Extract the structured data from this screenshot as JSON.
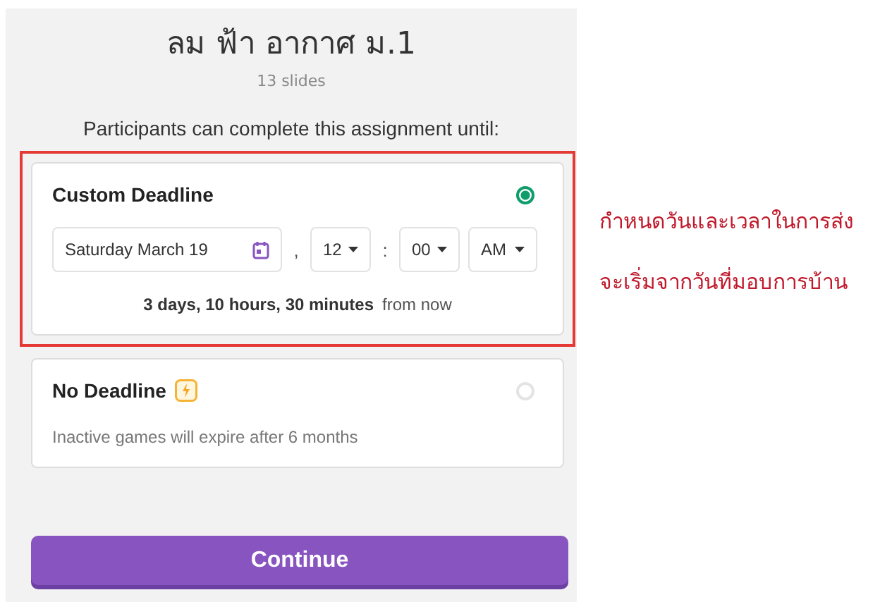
{
  "title": "ลม ฟ้า อากาศ ม.1",
  "subtitle": "13 slides",
  "prompt": "Participants can complete this assignment until:",
  "options": [
    {
      "kind": "custom",
      "title": "Custom Deadline",
      "selected": true,
      "highlighted": true,
      "date": "Saturday March 19",
      "comma": ",",
      "hour": "12",
      "colon": ":",
      "minute": "00",
      "period": "AM",
      "duration": "3 days, 10 hours, 30 minutes",
      "duration_suffix": "from now"
    },
    {
      "kind": "none",
      "title": "No Deadline",
      "selected": false,
      "highlighted": false,
      "note": "Inactive games will expire after 6 months"
    }
  ],
  "button": "Continue",
  "annotation": [
    "กำหนดวันและเวลาในการส่ง",
    "จะเริ่มจากวันที่มอบการบ้าน"
  ]
}
